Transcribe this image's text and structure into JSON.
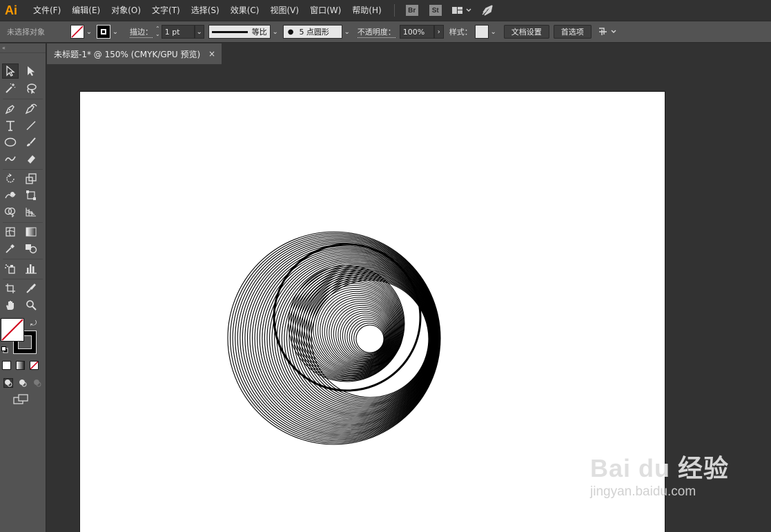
{
  "app": {
    "logo": "Ai"
  },
  "menu": [
    "文件(F)",
    "编辑(E)",
    "对象(O)",
    "文字(T)",
    "选择(S)",
    "效果(C)",
    "视图(V)",
    "窗口(W)",
    "帮助(H)"
  ],
  "menu_buttons": {
    "bridge": "Br",
    "stock": "St"
  },
  "control": {
    "selection_status": "未选择对象",
    "stroke_label": "描边：",
    "stroke_value": "1 pt",
    "profile_label": "等比",
    "brush_label": "5 点圆形",
    "opacity_label": "不透明度：",
    "opacity_value": "100%",
    "style_label": "样式：",
    "doc_setup_button": "文档设置",
    "preferences_button": "首选项"
  },
  "document": {
    "tab_title": "未标题-1* @ 150% (CMYK/GPU 预览)",
    "close_glyph": "×"
  },
  "watermark": {
    "brand": "Bai du 经验",
    "url": "jingyan.baidu.com"
  },
  "colors": {
    "ui_dark": "#323232",
    "panel": "#535353",
    "logo": "#ff9a00",
    "no_fill_slash": "#d0021b"
  },
  "icons": [
    "selection-tool-icon",
    "direct-selection-tool-icon",
    "magic-wand-icon",
    "lasso-icon",
    "pen-tool-icon",
    "curvature-tool-icon",
    "type-tool-icon",
    "line-tool-icon",
    "ellipse-tool-icon",
    "paintbrush-icon",
    "shaper-tool-icon",
    "eraser-icon",
    "rotate-tool-icon",
    "scale-tool-icon",
    "warp-tool-icon",
    "free-transform-icon",
    "shape-builder-icon",
    "perspective-grid-icon",
    "mesh-tool-icon",
    "gradient-tool-icon",
    "eyedropper-icon",
    "blend-tool-icon",
    "symbol-sprayer-icon",
    "column-graph-icon",
    "artboard-tool-icon",
    "slice-tool-icon",
    "hand-tool-icon",
    "zoom-tool-icon"
  ]
}
